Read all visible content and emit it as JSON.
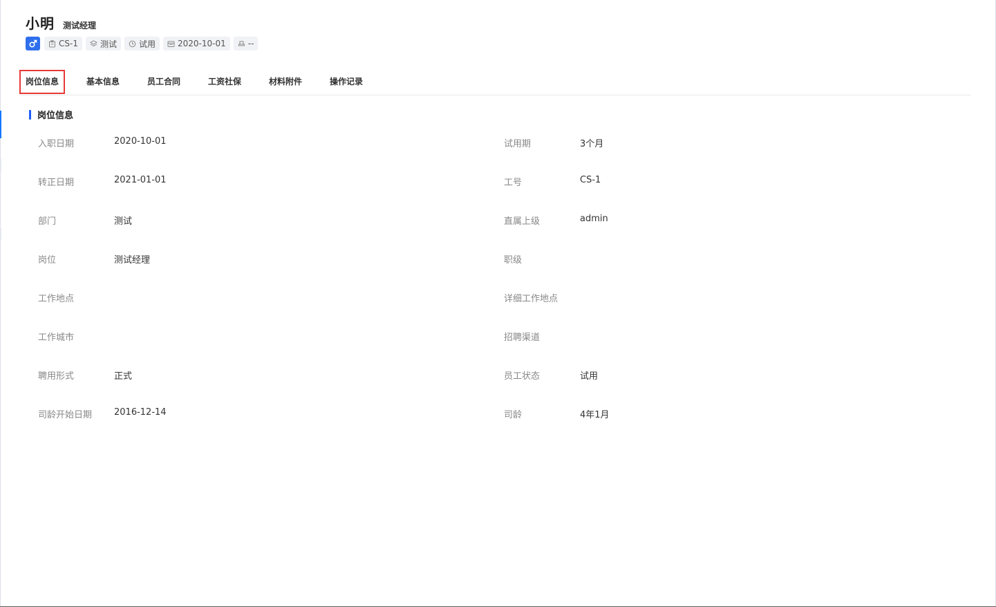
{
  "employee": {
    "name": "小明",
    "title": "测试经理",
    "gender_icon": "male-icon",
    "tags": [
      {
        "icon": "badge-icon",
        "label": "CS-1"
      },
      {
        "icon": "layers-icon",
        "label": "测试"
      },
      {
        "icon": "clock-icon",
        "label": "试用"
      },
      {
        "icon": "calendar-icon",
        "label": "2020-10-01"
      },
      {
        "icon": "seat-icon",
        "label": "--"
      }
    ]
  },
  "tabs": [
    {
      "label": "岗位信息",
      "active": true
    },
    {
      "label": "基本信息",
      "active": false
    },
    {
      "label": "员工合同",
      "active": false
    },
    {
      "label": "工资社保",
      "active": false
    },
    {
      "label": "材料附件",
      "active": false
    },
    {
      "label": "操作记录",
      "active": false
    }
  ],
  "section": {
    "title": "岗位信息"
  },
  "fields_left": [
    {
      "label": "入职日期",
      "value": "2020-10-01"
    },
    {
      "label": "转正日期",
      "value": "2021-01-01"
    },
    {
      "label": "部门",
      "value": "测试"
    },
    {
      "label": "岗位",
      "value": "测试经理"
    },
    {
      "label": "工作地点",
      "value": ""
    },
    {
      "label": "工作城市",
      "value": ""
    },
    {
      "label": "聘用形式",
      "value": "正式"
    },
    {
      "label": "司龄开始日期",
      "value": "2016-12-14"
    }
  ],
  "fields_right": [
    {
      "label": "试用期",
      "value": "3个月"
    },
    {
      "label": "工号",
      "value": "CS-1"
    },
    {
      "label": "直属上级",
      "value": "admin"
    },
    {
      "label": "职级",
      "value": ""
    },
    {
      "label": "详细工作地点",
      "value": ""
    },
    {
      "label": "招聘渠道",
      "value": ""
    },
    {
      "label": "员工状态",
      "value": "试用"
    },
    {
      "label": "司龄",
      "value": "4年1月"
    }
  ],
  "colors": {
    "accent": "#2f6fed",
    "highlight_border": "#e53935",
    "section_bar": "#1e5eff"
  }
}
